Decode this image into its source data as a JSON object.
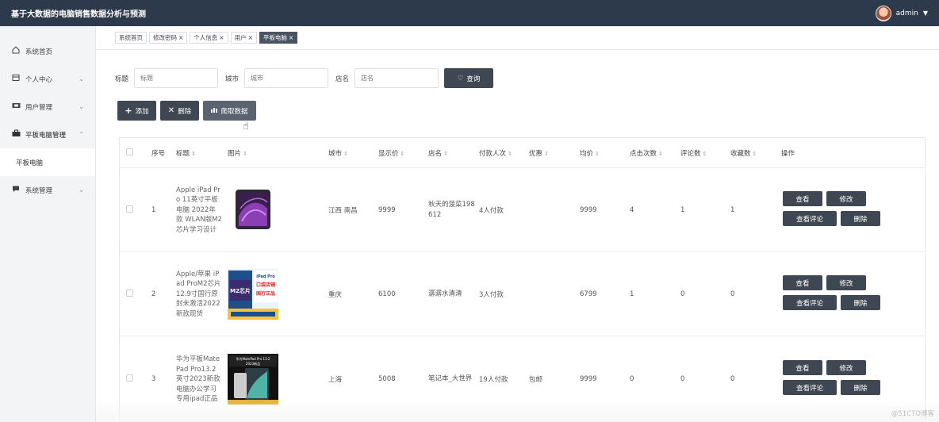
{
  "header": {
    "title": "基于大数据的电脑销售数据分析与预测",
    "username": "admin"
  },
  "sidebar": {
    "items": [
      {
        "label": "系统首页",
        "icon": "home-icon"
      },
      {
        "label": "个人中心",
        "icon": "person-card-icon"
      },
      {
        "label": "用户管理",
        "icon": "users-icon"
      },
      {
        "label": "平板电脑管理",
        "icon": "briefcase-icon"
      },
      {
        "label": "平板电脑",
        "icon": ""
      },
      {
        "label": "系统管理",
        "icon": "chat-icon"
      }
    ]
  },
  "tabs": [
    {
      "label": "系统首页",
      "closable": false,
      "active": false
    },
    {
      "label": "修改密码",
      "closable": true,
      "active": false
    },
    {
      "label": "个人信息",
      "closable": true,
      "active": false
    },
    {
      "label": "用户",
      "closable": true,
      "active": false
    },
    {
      "label": "平板电脑",
      "closable": true,
      "active": true
    }
  ],
  "search": {
    "title_label": "标题",
    "title_placeholder": "标题",
    "city_label": "城市",
    "city_placeholder": "城市",
    "shop_label": "店名",
    "shop_placeholder": "店名",
    "query_label": "查询"
  },
  "toolbar": {
    "add_label": "添加",
    "delete_label": "删除",
    "crawl_label": "爬取数据"
  },
  "table": {
    "columns": [
      "序号",
      "标题",
      "图片",
      "城市",
      "显示价",
      "店名",
      "付款人次",
      "优惠",
      "均价",
      "点击次数",
      "评论数",
      "收藏数",
      "操作"
    ],
    "rows": [
      {
        "index": "1",
        "title": "Apple iPad Pro 11英寸平板电脑 2022年款 WLAN版M2芯片学习设计",
        "city": "江西 南昌",
        "price": "9999",
        "shop": "秋天的菠菜198612",
        "payers": "4人付款",
        "discount": "",
        "avg_price": "9999",
        "clicks": "4",
        "comments": "1",
        "favorites": "1"
      },
      {
        "index": "2",
        "title": "Apple/苹果 iPad ProM2芯片12.9寸国行原封未激活2022新款现货",
        "city": "重庆",
        "price": "6100",
        "shop": "潺潺水清清",
        "payers": "3人付款",
        "discount": "",
        "avg_price": "6799",
        "clicks": "1",
        "comments": "0",
        "favorites": "0"
      },
      {
        "index": "3",
        "title": "华为平板MatePad Pro13.2英寸2023新款电脑办公学习专用ipad正品",
        "city": "上海",
        "price": "5008",
        "shop": "笔记本_大世界",
        "payers": "19人付款",
        "discount": "包邮",
        "avg_price": "9999",
        "clicks": "0",
        "comments": "0",
        "favorites": "0"
      }
    ],
    "ops": {
      "view": "查看",
      "edit": "修改",
      "view_comments": "查看评论",
      "delete": "删除"
    }
  },
  "images": {
    "img2_text_top": "iPad Pro",
    "img2_text_mid": "M2芯片",
    "img2_text_side": "口袋店铺",
    "img2_text_side2": "国行正品",
    "img3_text_top": "华为MatePad Pro 13.2",
    "img3_text_mid": "2023新品"
  },
  "watermark": "@51CTO博客"
}
